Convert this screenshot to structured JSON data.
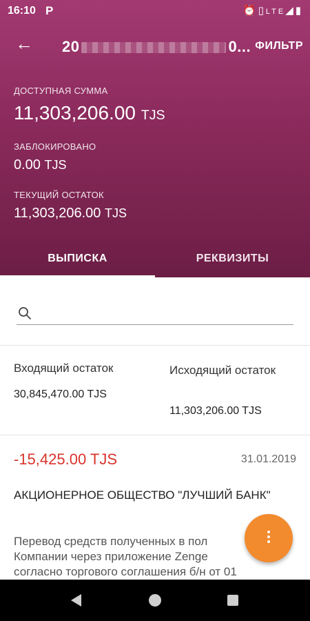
{
  "status_bar": {
    "time": "16:10",
    "app_badge": "P",
    "icons": [
      "alarm-icon",
      "vibrate-icon",
      "lte-icon",
      "signal-icon",
      "battery-icon"
    ]
  },
  "app_bar": {
    "title_start": "20",
    "title_end": "0...",
    "filter_label": "ФИЛЬТР"
  },
  "balances": {
    "available": {
      "label": "ДОСТУПНАЯ СУММА",
      "amount": "11,303,206.00",
      "currency": "TJS"
    },
    "blocked": {
      "label": "ЗАБЛОКИРОВАНО",
      "amount": "0.00",
      "currency": "TJS"
    },
    "current": {
      "label": "ТЕКУЩИЙ ОСТАТОК",
      "amount": "11,303,206.00",
      "currency": "TJS"
    }
  },
  "tabs": [
    {
      "label": "ВЫПИСКА",
      "active": true
    },
    {
      "label": "РЕКВИЗИТЫ",
      "active": false
    }
  ],
  "search": {
    "value": "",
    "placeholder": ""
  },
  "summary": {
    "opening_label": "Входящий остаток",
    "opening_value": "30,845,470.00 TJS",
    "closing_label": "Исходящий остаток",
    "closing_value": "11,303,206.00 TJS"
  },
  "transactions": [
    {
      "amount": "-15,425.00 TJS",
      "date": "31.01.2019",
      "counterparty": "АКЦИОНЕРНОЕ ОБЩЕСТВО \"ЛУЧШИЙ БАНК\"",
      "description_lines": [
        "Перевод средств полученных в пол",
        "Компании через приложение Zenge",
        "согласно торгового соглашения б/н от 01"
      ]
    }
  ],
  "colors": {
    "header_top": "#a33a72",
    "header_bottom": "#6c1e45",
    "negative_amount": "#d9342b",
    "fab": "#f28a2e"
  }
}
